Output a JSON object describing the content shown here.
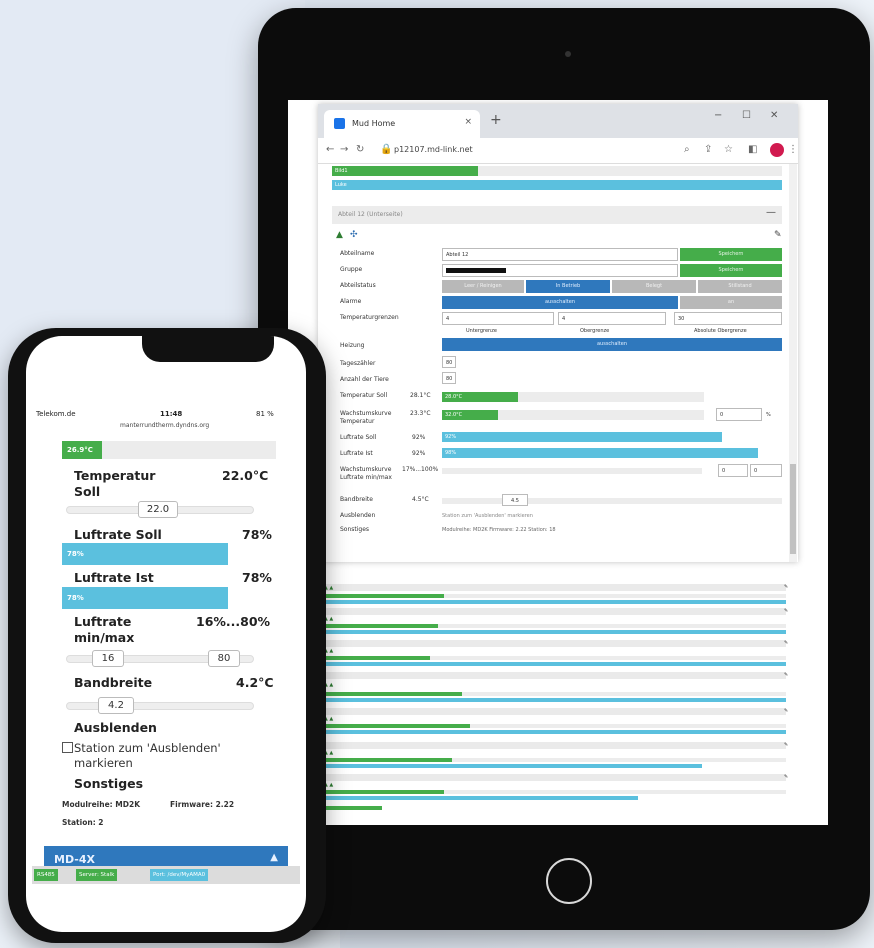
{
  "tablet": {
    "browser": {
      "tab_title": "Mud Home",
      "url": "p12107.md-link.net",
      "new_tab": "+",
      "close_tab": "×",
      "win_min": "−",
      "win_max": "☐",
      "win_close": "✕"
    },
    "top_bars": {
      "green_label": "Bild1",
      "blue_label": "Luke"
    },
    "section": {
      "title": "Abteil 12 (Unterseite)",
      "collapse": "—",
      "fields": {
        "name_label": "Abteilname",
        "name_value": "Abteil 12",
        "group_label": "Gruppe",
        "status_label": "Abteilstatus",
        "alarm_label": "Alarme",
        "temp_limits_label": "Temperaturgrenzen",
        "heating_label": "Heizung",
        "pig_count_label": "Tageszähler",
        "animals_label": "Anzahl der Tiere",
        "temp_soll_label": "Temperatur Soll",
        "temp_soll_val": "28.1°C",
        "temp_soll_bar": "28.0°C",
        "growth_label": "Wachstumskurve Temperatur",
        "growth_val": "23.3°C",
        "growth_bar": "32.0°C",
        "luft_soll_label": "Luftrate Soll",
        "luft_soll_val": "92%",
        "luft_soll_bar": "92%",
        "luft_ist_label": "Luftrate Ist",
        "luft_ist_val": "92%",
        "luft_ist_bar": "98%",
        "luft_minmax_label": "Wachstumskurve Luftrate min/max",
        "luft_minmax_val": "17%...100%",
        "band_label": "Bandbreite",
        "band_val": "4.5°C",
        "band_input": "4.5",
        "hide_label": "Ausblenden",
        "hide_text": "Station zum 'Ausblenden' markieren",
        "misc_label": "Sonstiges",
        "misc_text": "Modulreihe: MD2K    Firmware: 2.22    Station: 18",
        "temp_low_caption": "Untergrenze",
        "temp_high_caption": "Obergrenze",
        "temp_abs_caption": "Absolute Obergrenze",
        "temp_low": "4",
        "temp_high": "4",
        "temp_abs": "30",
        "pig_count_value": "80",
        "animals_value": "80",
        "growth_input": "0",
        "percent_unit": "%",
        "minmax_input1": "0",
        "minmax_input2": "0"
      },
      "buttons": {
        "save1": "Speichern",
        "save2": "Speichern",
        "status_left": "Leer / Reinigen",
        "status_active": "In Betrieb",
        "status_right1": "Belegt",
        "status_right2": "Stillstand",
        "alarm_off": "ausschalten",
        "alarm_on": "an",
        "heat_on": "ausschalten"
      }
    }
  },
  "phone": {
    "status": {
      "carrier": "Telekom.de",
      "time": "11:48",
      "battery": "81 %",
      "url": "manterrundtherm.dyndns.org"
    },
    "top_bar": "26.9°C",
    "temp_soll": {
      "label": "Temperatur Soll",
      "value": "22.0°C",
      "slider": "22.0"
    },
    "luft_soll": {
      "label": "Luftrate Soll",
      "value": "78%",
      "bar": "78%"
    },
    "luft_ist": {
      "label": "Luftrate Ist",
      "value": "78%",
      "bar": "78%"
    },
    "luft_minmax": {
      "label": "Luftrate min/max",
      "value": "16%...80%",
      "min": "16",
      "max": "80"
    },
    "band": {
      "label": "Bandbreite",
      "value": "4.2°C",
      "slider": "4.2"
    },
    "hide": {
      "label": "Ausblenden",
      "checkbox_text": "Station zum 'Ausblenden' markieren"
    },
    "misc": {
      "label": "Sonstiges",
      "model": "Modulreihe: MD2K",
      "firmware": "Firmware: 2.22",
      "station": "Station: 2"
    },
    "next_header": "MD-4X",
    "footer": {
      "tag1": "RS485",
      "tag2": "Server: Stalk",
      "tag3": "Port: /dev/MyAMA0"
    }
  },
  "colors": {
    "green": "#45ad4a",
    "blue": "#5bc0de",
    "dark_blue": "#2f78bd"
  }
}
